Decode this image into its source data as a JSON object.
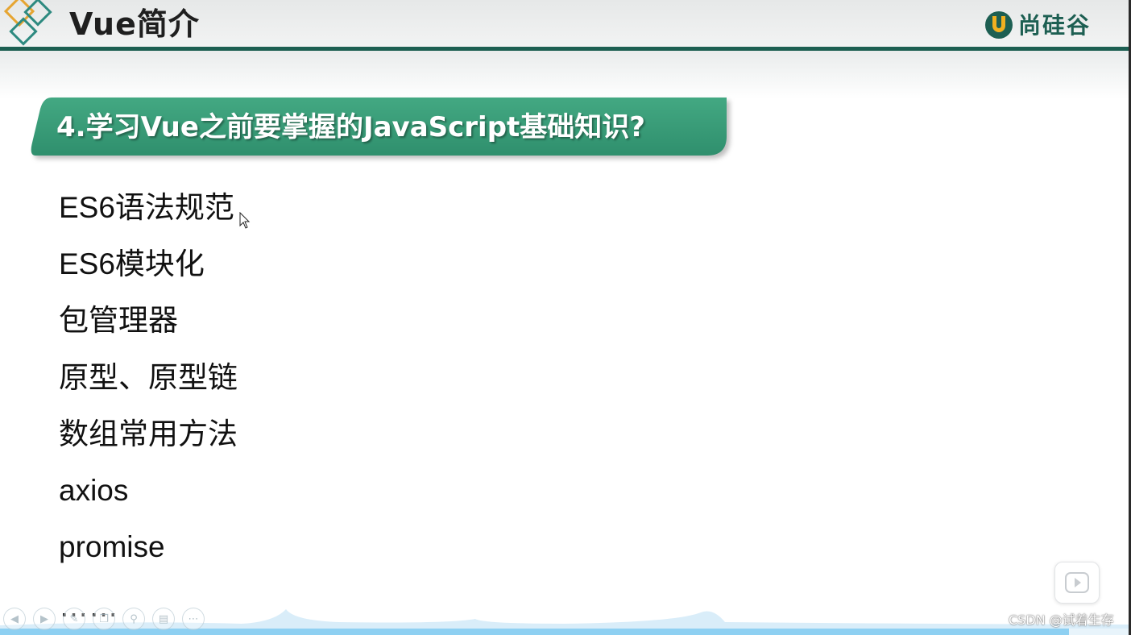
{
  "slide": {
    "title": "Vue简介",
    "brand_name": "尚硅谷",
    "section_heading": "4.学习Vue之前要掌握的JavaScript基础知识?",
    "items": [
      "ES6语法规范",
      "ES6模块化",
      "包管理器",
      "原型、原型链",
      "数组常用方法",
      "axios",
      "promise",
      "……"
    ]
  },
  "colors": {
    "theme_green": "#1d5f52",
    "banner_green": "#3a9c78",
    "logo_orange": "#e6a532",
    "logo_teal": "#2e8a80"
  },
  "player": {
    "progress": 0.945,
    "controls": [
      "previous-icon",
      "next-icon",
      "pen-icon",
      "copy-icon",
      "zoom-icon",
      "screen-icon",
      "more-icon"
    ]
  },
  "watermark": "CSDN @试着生存"
}
